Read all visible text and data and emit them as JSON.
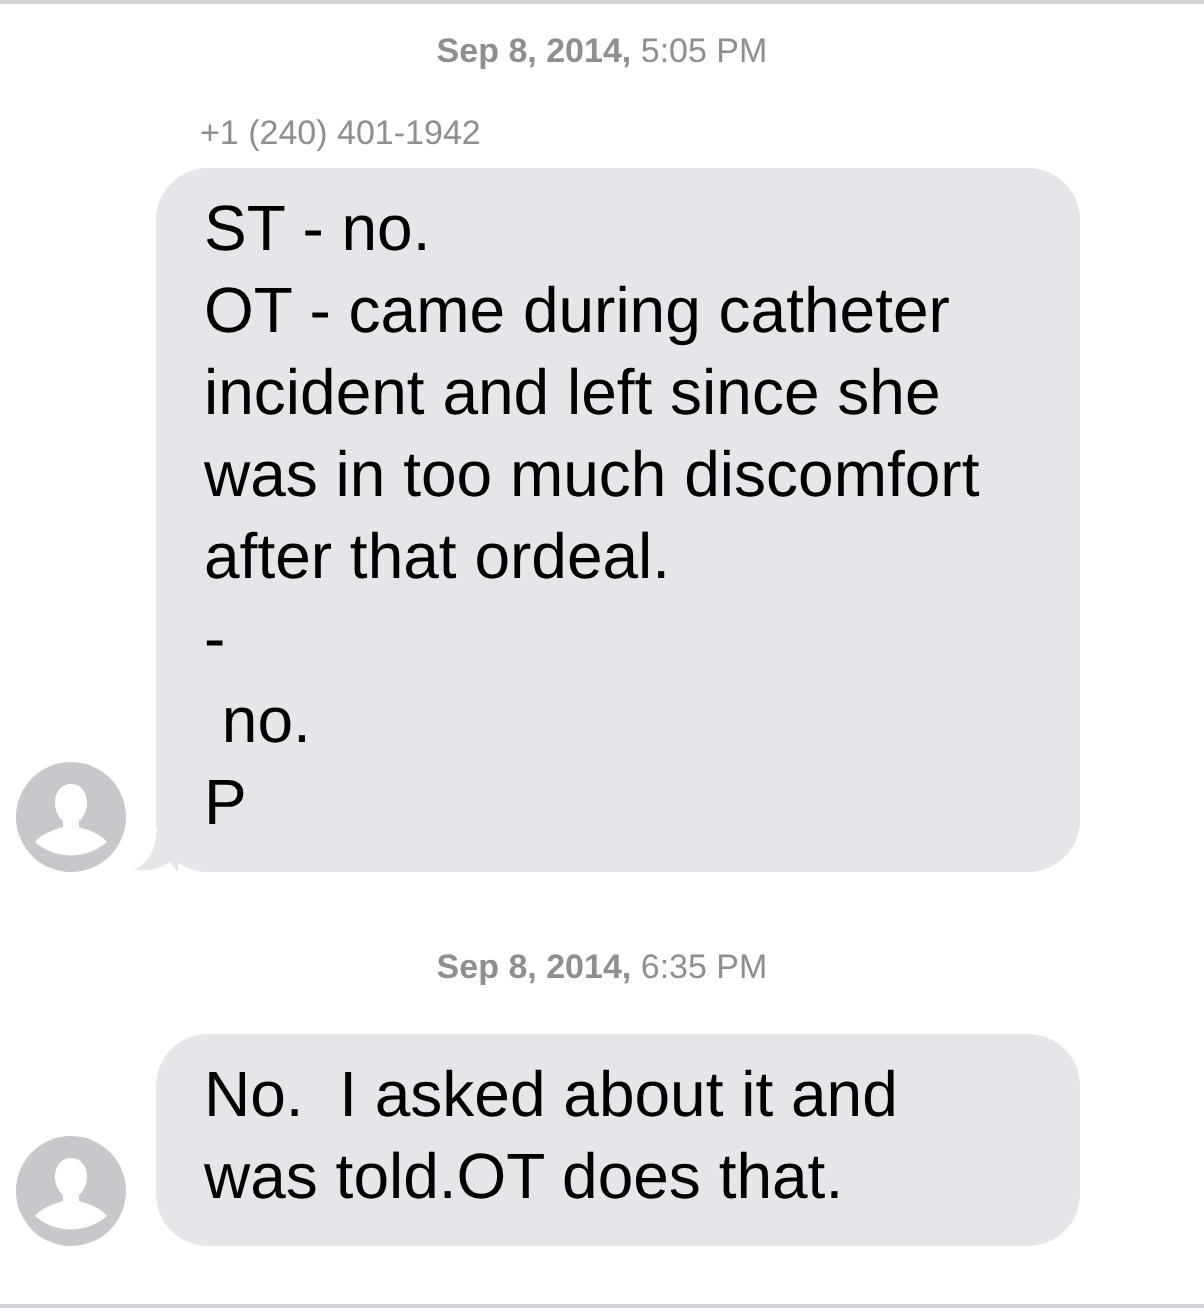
{
  "conversation": [
    {
      "kind": "timestamp",
      "text": "**Sep 8, 2014,** 5:05 PM"
    },
    {
      "kind": "message",
      "sender": "+1 (240) 401-1942",
      "text": "ST - no.\nOT - came during catheter incident and left since she was in too much discomfort after that ordeal.\n-\n no.\nP",
      "tail": true
    },
    {
      "kind": "timestamp",
      "text": "**Sep 8, 2014,** 6:35 PM"
    },
    {
      "kind": "message",
      "text": "No.  I asked about it and was told.OT does that.",
      "tail": false
    }
  ]
}
